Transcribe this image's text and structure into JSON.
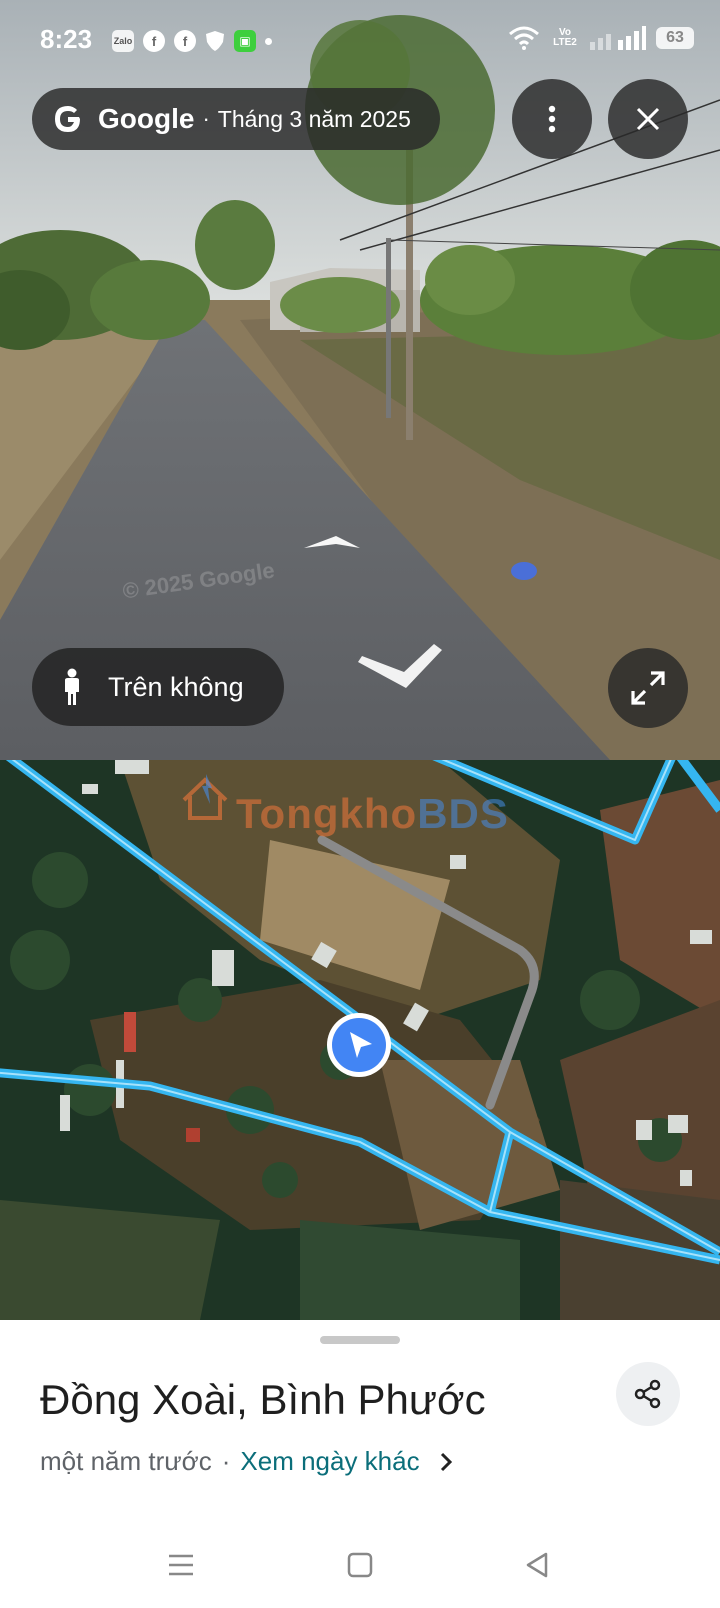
{
  "status_bar": {
    "time": "8:23",
    "apps": [
      {
        "icon": "zalo-icon",
        "text": "Zalo"
      },
      {
        "icon": "facebook-icon",
        "text": "f"
      },
      {
        "icon": "facebook-icon",
        "text": "f"
      },
      {
        "icon": "shield-icon",
        "text": ""
      },
      {
        "icon": "gift-icon",
        "text": ""
      }
    ],
    "network": "Vo LTE2",
    "battery": "63"
  },
  "streetview": {
    "brand": "Google",
    "separator": "·",
    "capture_date": "Tháng 3 năm 2025",
    "aerial_label": "Trên không",
    "watermark": "© 2025 Google"
  },
  "map": {
    "watermark_a": "Tongkho",
    "watermark_b": "BDS"
  },
  "sheet": {
    "title": "Đồng Xoài, Bình Phước",
    "age": "một năm trước",
    "dot": "·",
    "other_dates_link": "Xem ngày khác"
  },
  "colors": {
    "map_road": "#35b6f0",
    "location_marker": "#4285f4",
    "link": "#0b6e7a"
  }
}
